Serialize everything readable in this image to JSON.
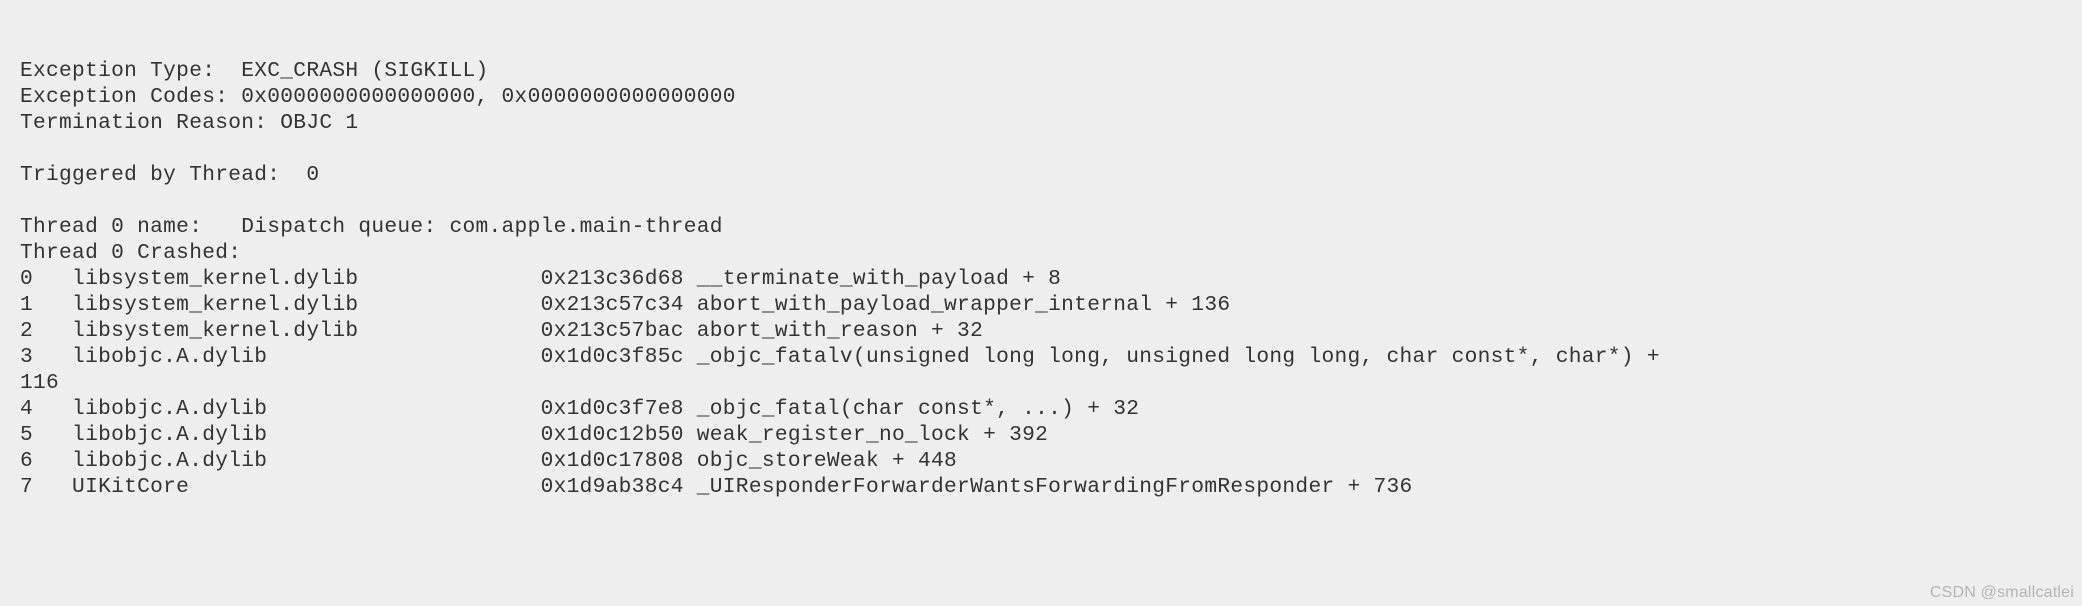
{
  "crash": {
    "line_top": "",
    "exception_type": "Exception Type:  EXC_CRASH (SIGKILL)",
    "exception_codes": "Exception Codes: 0x0000000000000000, 0x0000000000000000",
    "termination_reason": "Termination Reason: OBJC 1",
    "blank1": "",
    "triggered_by": "Triggered by Thread:  0",
    "blank2": "",
    "thread_name": "Thread 0 name:   Dispatch queue: com.apple.main-thread",
    "thread_crashed": "Thread 0 Crashed:",
    "frame0": "0   libsystem_kernel.dylib              0x213c36d68 __terminate_with_payload + 8",
    "frame1": "1   libsystem_kernel.dylib              0x213c57c34 abort_with_payload_wrapper_internal + 136",
    "frame2": "2   libsystem_kernel.dylib              0x213c57bac abort_with_reason + 32",
    "frame3a": "3   libobjc.A.dylib                     0x1d0c3f85c _objc_fatalv(unsigned long long, unsigned long long, char const*, char*) +",
    "frame3b": "116",
    "frame4": "4   libobjc.A.dylib                     0x1d0c3f7e8 _objc_fatal(char const*, ...) + 32",
    "frame5": "5   libobjc.A.dylib                     0x1d0c12b50 weak_register_no_lock + 392",
    "frame6": "6   libobjc.A.dylib                     0x1d0c17808 objc_storeWeak + 448",
    "frame7": "7   UIKitCore                           0x1d9ab38c4 _UIResponderForwarderWantsForwardingFromResponder + 736"
  },
  "watermark": "CSDN @smallcatlei"
}
